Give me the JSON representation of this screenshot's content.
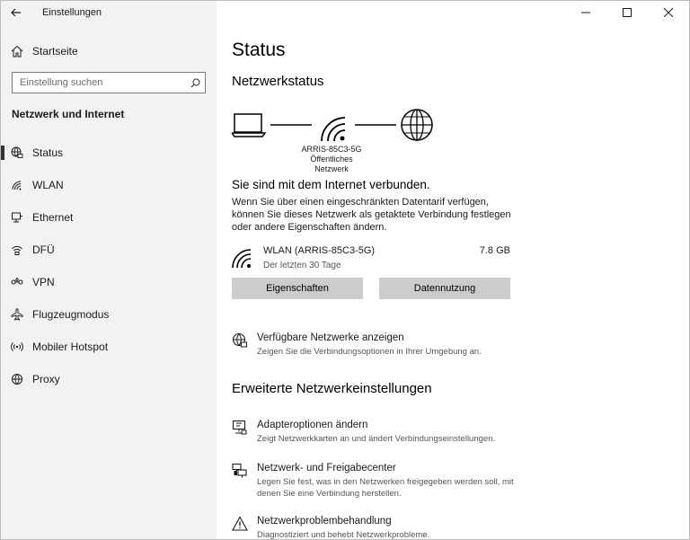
{
  "window": {
    "app_title": "Einstellungen"
  },
  "sidebar": {
    "home_label": "Startseite",
    "search_placeholder": "Einstellung suchen",
    "section_title": "Netzwerk und Internet",
    "items": [
      {
        "label": "Status",
        "icon": "globe-network-icon",
        "active": true
      },
      {
        "label": "WLAN",
        "icon": "wifi-icon"
      },
      {
        "label": "Ethernet",
        "icon": "ethernet-icon"
      },
      {
        "label": "DFÜ",
        "icon": "dialup-icon"
      },
      {
        "label": "VPN",
        "icon": "vpn-icon"
      },
      {
        "label": "Flugzeugmodus",
        "icon": "airplane-icon"
      },
      {
        "label": "Mobiler Hotspot",
        "icon": "hotspot-icon"
      },
      {
        "label": "Proxy",
        "icon": "globe-icon"
      }
    ]
  },
  "main": {
    "title": "Status",
    "network_status_heading": "Netzwerkstatus",
    "network_name": "ARRIS-85C3-5G",
    "network_type": "Öffentliches Netzwerk",
    "connected_text": "Sie sind mit dem Internet verbunden.",
    "description": "Wenn Sie über einen eingeschränkten Datentarif verfügen, können Sie dieses Netzwerk als getaktete Verbindung festlegen oder andere Eigenschaften ändern.",
    "connection": {
      "name": "WLAN (ARRIS-85C3-5G)",
      "period": "Der letzten 30 Tage",
      "usage": "7.8 GB"
    },
    "buttons": {
      "properties": "Eigenschaften",
      "data_usage": "Datennutzung"
    },
    "available_networks": {
      "title": "Verfügbare Netzwerke anzeigen",
      "subtitle": "Zeigen Sie die Verbindungsoptionen in Ihrer Umgebung an."
    },
    "advanced_heading": "Erweiterte Netzwerkeinstellungen",
    "advanced_links": [
      {
        "title": "Adapteroptionen ändern",
        "subtitle": "Zeigt Netzwerkkarten an und ändert Verbindungseinstellungen."
      },
      {
        "title": "Netzwerk- und Freigabecenter",
        "subtitle": "Legen Sie fest, was in den Netzwerken freigegeben werden soll, mit denen Sie eine Verbindung herstellen."
      },
      {
        "title": "Netzwerkproblembehandlung",
        "subtitle": "Diagnostiziert und behebt Netzwerkprobleme."
      }
    ]
  }
}
